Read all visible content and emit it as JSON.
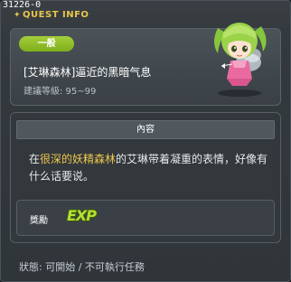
{
  "quest": {
    "id_label": "31226-0",
    "window_title": "QUEST INFO",
    "category": "一般",
    "name": "[艾琳森林]逼近的黑暗气息",
    "level_text": "建議等級: 95~99",
    "content_header": "內容",
    "description_pre": "在",
    "description_highlight": "很深的妖精森林",
    "description_post": "的艾琳带着凝重的表情，好像有什么话要说。",
    "reward_label": "獎勵",
    "reward_exp": "EXP",
    "status_text": "狀態:  可開始  / 不可執行任務"
  },
  "colors": {
    "accent_yellow": "#e8c64a",
    "badge_green": "#8dbb25",
    "exp_green": "#b6e034",
    "panel": "#34393d"
  },
  "icons": {
    "npc": "fairy-npc-portrait",
    "title_star": "star-icon"
  }
}
